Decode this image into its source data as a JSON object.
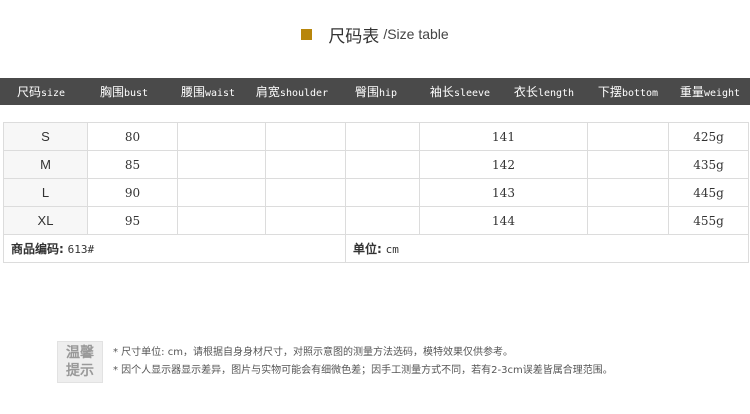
{
  "title": {
    "cn": "尺码表",
    "en": "/Size table"
  },
  "headers": [
    {
      "cn": "尺码",
      "en": "size"
    },
    {
      "cn": "胸围",
      "en": "bust"
    },
    {
      "cn": "腰围",
      "en": "waist"
    },
    {
      "cn": "肩宽",
      "en": "shoulder"
    },
    {
      "cn": "臀围",
      "en": "hip"
    },
    {
      "cn": "袖长",
      "en": "sleeve"
    },
    {
      "cn": "衣长",
      "en": "length"
    },
    {
      "cn": "下摆",
      "en": "bottom"
    },
    {
      "cn": "重量",
      "en": "weight"
    }
  ],
  "rows": [
    {
      "size": "S",
      "bust": "80",
      "waist": "",
      "shoulder": "",
      "hip": "",
      "sleeve": "",
      "length": "141",
      "bottom": "",
      "weight": "425g"
    },
    {
      "size": "M",
      "bust": "85",
      "waist": "",
      "shoulder": "",
      "hip": "",
      "sleeve": "",
      "length": "142",
      "bottom": "",
      "weight": "435g"
    },
    {
      "size": "L",
      "bust": "90",
      "waist": "",
      "shoulder": "",
      "hip": "",
      "sleeve": "",
      "length": "143",
      "bottom": "",
      "weight": "445g"
    },
    {
      "size": "XL",
      "bust": "95",
      "waist": "",
      "shoulder": "",
      "hip": "",
      "sleeve": "",
      "length": "144",
      "bottom": "",
      "weight": "455g"
    }
  ],
  "footer": {
    "code_label": "商品编码:",
    "code_value": "613#",
    "unit_label": "单位:",
    "unit_value": "cm"
  },
  "notes": {
    "badge_top": "温馨",
    "badge_bottom": "提示",
    "line1": "* 尺寸单位: cm，请根据自身身材尺寸，对照示意图的测量方法选码，模特效果仅供参考。",
    "line2": "* 因个人显示器显示差异，图片与实物可能会有细微色差；因手工测量方式不同，若有2-3cm误差皆属合理范围。"
  },
  "colors": {
    "accent": "#b8860b",
    "header_bg": "#4a4a4a"
  }
}
